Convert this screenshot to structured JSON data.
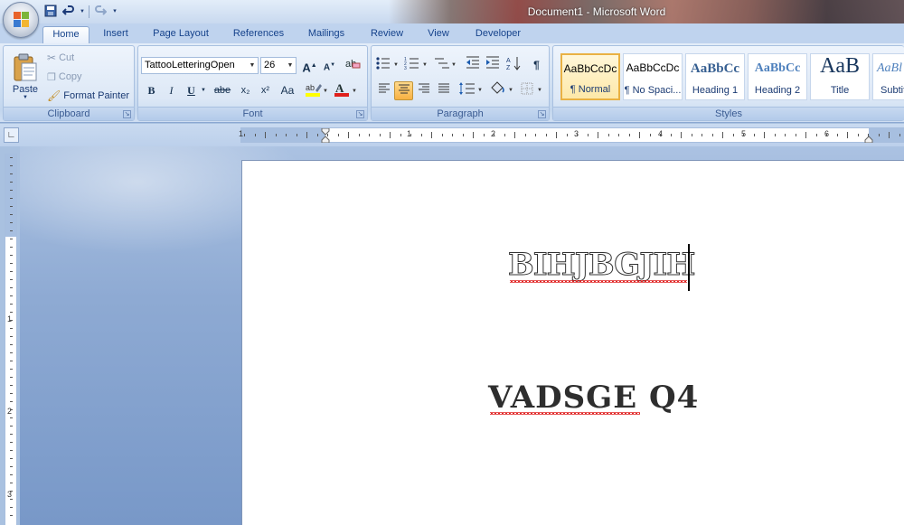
{
  "window": {
    "title": "Document1 - Microsoft Word"
  },
  "qat": {
    "items": [
      "save-icon",
      "undo-icon",
      "redo-icon",
      "customize-icon"
    ]
  },
  "tabs": [
    {
      "label": "Home",
      "active": true
    },
    {
      "label": "Insert"
    },
    {
      "label": "Page Layout"
    },
    {
      "label": "References"
    },
    {
      "label": "Mailings"
    },
    {
      "label": "Review"
    },
    {
      "label": "View"
    },
    {
      "label": "Developer"
    }
  ],
  "clipboard": {
    "group_label": "Clipboard",
    "paste_label": "Paste",
    "cut_label": "Cut",
    "copy_label": "Copy",
    "format_painter_label": "Format Painter"
  },
  "font": {
    "group_label": "Font",
    "font_name": "TattooLetteringOpen",
    "font_size": "26",
    "bold": "B",
    "italic": "I",
    "underline": "U",
    "strike": "abe",
    "subscript": "x₂",
    "superscript": "x²",
    "change_case": "Aa",
    "grow": "A",
    "shrink": "A"
  },
  "paragraph": {
    "group_label": "Paragraph",
    "pilcrow": "¶"
  },
  "styles": {
    "group_label": "Styles",
    "items": [
      {
        "sample": "AaBbCcDc",
        "name": "¶ Normal",
        "selected": true
      },
      {
        "sample": "AaBbCcDc",
        "name": "¶ No Spaci..."
      },
      {
        "sample": "AaBbCc",
        "name": "Heading 1"
      },
      {
        "sample": "AaBbCc",
        "name": "Heading 2"
      },
      {
        "sample": "AaB",
        "name": "Title"
      },
      {
        "sample": "AaBl",
        "name": "Subtitle"
      }
    ]
  },
  "ruler": {
    "numbers": [
      "1",
      "1",
      "2",
      "3",
      "4",
      "5",
      "6"
    ]
  },
  "vruler": {
    "numbers": [
      "1",
      "2",
      "3"
    ]
  },
  "document": {
    "line1": "BIHJBGJIH",
    "line2": "VADSGE Q4"
  },
  "colors": {
    "accent": "#15428b",
    "highlight": "#f8b143",
    "spell_error": "#e02020"
  }
}
